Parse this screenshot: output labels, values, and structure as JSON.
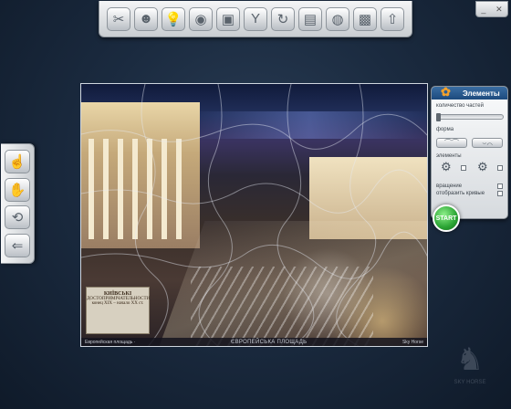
{
  "window_controls": {
    "minimize": "_",
    "close": "✕"
  },
  "toolbar": {
    "icons": [
      "tools-icon",
      "people-icon",
      "bulb-icon",
      "disc-icon",
      "image-icon",
      "fork-icon",
      "refresh-icon",
      "bag-icon",
      "dvd-icon",
      "gallery-icon",
      "upload-icon"
    ],
    "glyphs": [
      "✂",
      "☻",
      "💡",
      "◉",
      "▣",
      "Y",
      "↻",
      "▤",
      "◍",
      "▩",
      "⇧"
    ]
  },
  "left_toolbar": {
    "icons": [
      "hand-pointer-icon",
      "hand-open-icon",
      "rotate-icon",
      "exit-icon"
    ],
    "glyphs": [
      "☝",
      "✋",
      "⟲",
      "⇐"
    ]
  },
  "photo": {
    "poster_title": "КИЇВСЬКІ",
    "poster_subtitle": "ДОСТОПРИМІЧАТЕЛЬНОСТИ",
    "poster_sub2": "конец XIX – начало XX ст.",
    "caption_left": "Европейская площадь ·",
    "caption_center": "ЄВРОПЕЙСЬКА ПЛОЩАДЬ",
    "caption_right": "Sky Horse"
  },
  "panel": {
    "title": "Элементы",
    "pieces_label": "количество частей",
    "shape_label": "форма",
    "elements_label": "элементы",
    "rotation_label": "вращение",
    "show_curves_label": "отобразить кривые"
  },
  "start_button": {
    "label": "START"
  },
  "watermark": {
    "text": "SKY HORSE"
  }
}
